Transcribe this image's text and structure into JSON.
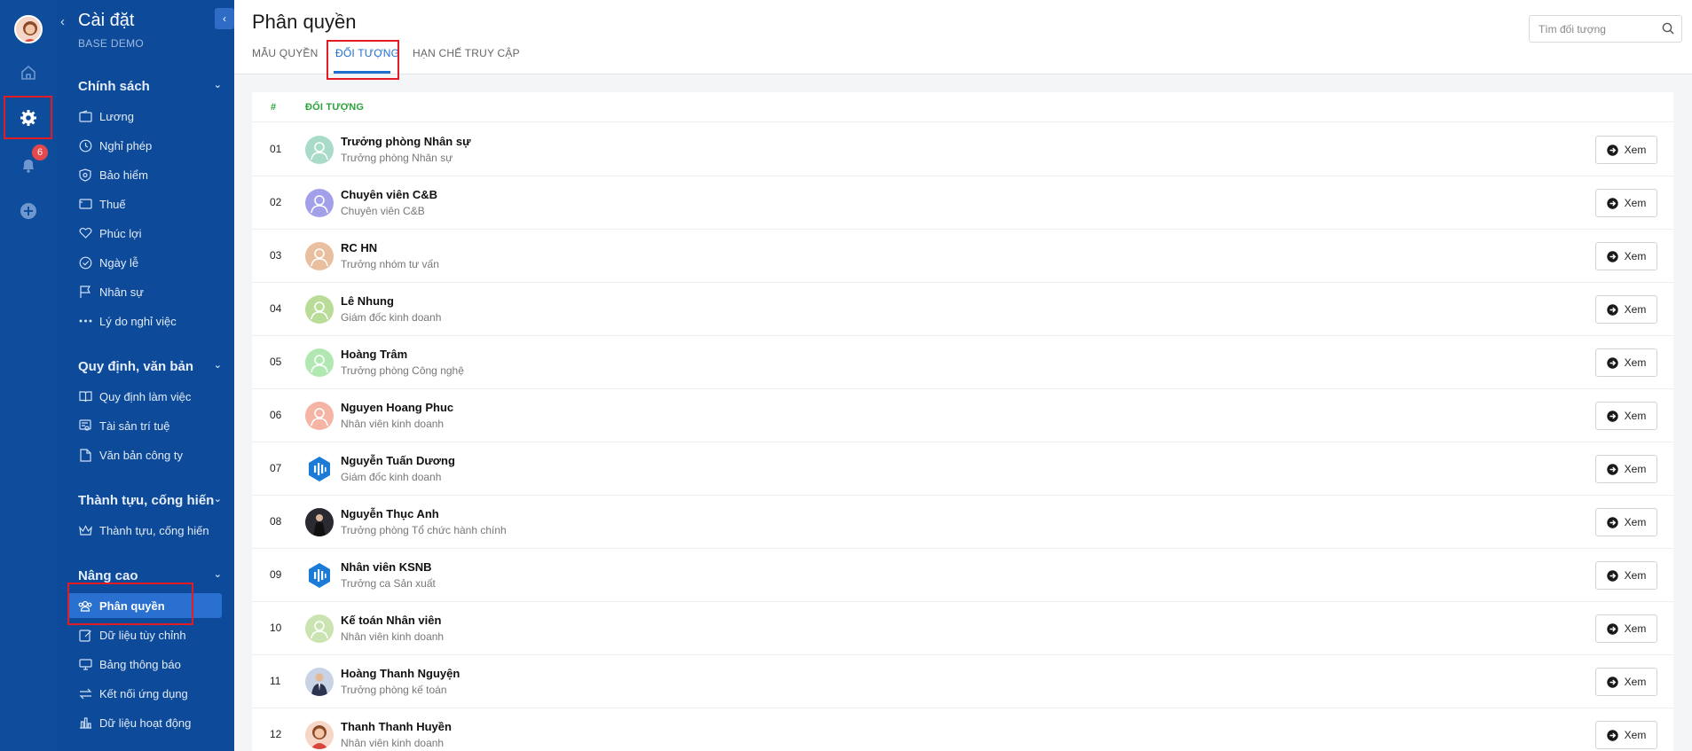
{
  "rail": {
    "notification_count": "6"
  },
  "sidebar": {
    "title": "Cài đặt",
    "subtitle": "BASE DEMO",
    "sections": [
      {
        "title": "Chính sách",
        "items": [
          {
            "label": "Lương",
            "icon": "wallet-icon"
          },
          {
            "label": "Nghỉ phép",
            "icon": "clock-icon"
          },
          {
            "label": "Bảo hiểm",
            "icon": "shield-icon"
          },
          {
            "label": "Thuế",
            "icon": "card-icon"
          },
          {
            "label": "Phúc lợi",
            "icon": "hands-heart-icon"
          },
          {
            "label": "Ngày lễ",
            "icon": "check-circle-icon"
          },
          {
            "label": "Nhân sự",
            "icon": "flag-icon"
          },
          {
            "label": "Lý do nghỉ việc",
            "icon": "dots-icon"
          }
        ]
      },
      {
        "title": "Quy định, văn bản",
        "items": [
          {
            "label": "Quy định làm việc",
            "icon": "book-icon"
          },
          {
            "label": "Tài sản trí tuệ",
            "icon": "certificate-icon"
          },
          {
            "label": "Văn bản công ty",
            "icon": "document-icon"
          }
        ]
      },
      {
        "title": "Thành tựu, cống hiến",
        "items": [
          {
            "label": "Thành tựu, cống hiến",
            "icon": "crown-icon"
          }
        ]
      },
      {
        "title": "Nâng cao",
        "items": [
          {
            "label": "Phân quyền",
            "icon": "users-icon",
            "active": true
          },
          {
            "label": "Dữ liệu tùy chỉnh",
            "icon": "edit-icon"
          },
          {
            "label": "Bảng thông báo",
            "icon": "monitor-icon"
          },
          {
            "label": "Kết nối ứng dụng",
            "icon": "exchange-icon"
          },
          {
            "label": "Dữ liệu hoạt động",
            "icon": "chart-icon"
          }
        ]
      }
    ]
  },
  "header": {
    "title": "Phân quyền",
    "tabs": [
      {
        "label": "MẪU QUYỀN",
        "active": false
      },
      {
        "label": "ĐỐI TƯỢNG",
        "active": true
      },
      {
        "label": "HẠN CHẾ TRUY CẬP",
        "active": false
      }
    ],
    "search_placeholder": "Tìm đối tượng"
  },
  "table": {
    "columns": [
      "#",
      "ĐỐI TƯỢNG"
    ],
    "view_label": "Xem",
    "rows": [
      {
        "num": "01",
        "name": "Trưởng phòng Nhân sự",
        "role": "Trưởng phòng Nhân sự",
        "avatar": "placeholder",
        "color": "#a8dcc8"
      },
      {
        "num": "02",
        "name": "Chuyên viên C&B",
        "role": "Chuyên viên C&B",
        "avatar": "placeholder",
        "color": "#a3a0ea"
      },
      {
        "num": "03",
        "name": "RC HN",
        "role": "Trưởng nhóm tư vấn",
        "avatar": "placeholder",
        "color": "#e9bfa0"
      },
      {
        "num": "04",
        "name": "Lê Nhung",
        "role": "Giám đốc kinh doanh",
        "avatar": "placeholder",
        "color": "#b9dc98"
      },
      {
        "num": "05",
        "name": "Hoàng Trâm",
        "role": "Trưởng phòng Công nghệ",
        "avatar": "placeholder",
        "color": "#b1e8b1"
      },
      {
        "num": "06",
        "name": "Nguyen Hoang Phuc",
        "role": "Nhân viên kinh doanh",
        "avatar": "placeholder",
        "color": "#f5b4a4"
      },
      {
        "num": "07",
        "name": "Nguyễn Tuấn Dương",
        "role": "Giám đốc kinh doanh",
        "avatar": "logo",
        "color": "#1d7bd8"
      },
      {
        "num": "08",
        "name": "Nguyễn Thục Anh",
        "role": "Trưởng phòng Tổ chức hành chính",
        "avatar": "photo-dark",
        "color": "#2a2a33"
      },
      {
        "num": "09",
        "name": "Nhân viên KSNB",
        "role": "Trưởng ca Sản xuất",
        "avatar": "logo",
        "color": "#1d7bd8"
      },
      {
        "num": "10",
        "name": "Kế toán Nhân viên",
        "role": "Nhân viên kinh doanh",
        "avatar": "placeholder",
        "color": "#c9e4b0"
      },
      {
        "num": "11",
        "name": "Hoàng Thanh Nguyện",
        "role": "Trưởng phòng kế toán",
        "avatar": "photo-person",
        "color": "#c8d3e6"
      },
      {
        "num": "12",
        "name": "Thanh Thanh Huyền",
        "role": "Nhân viên kinh doanh",
        "avatar": "cartoon",
        "color": "#f6d7c7"
      }
    ]
  }
}
